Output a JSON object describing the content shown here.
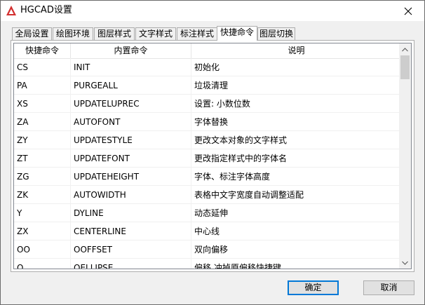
{
  "window": {
    "title": "HGCAD设置"
  },
  "tabs": [
    {
      "label": "全局设置"
    },
    {
      "label": "绘图环境"
    },
    {
      "label": "图层样式"
    },
    {
      "label": "文字样式"
    },
    {
      "label": "标注样式"
    },
    {
      "label": "快捷命令",
      "active": true
    },
    {
      "label": "图层切换"
    }
  ],
  "table": {
    "headers": [
      "快捷命令",
      "内置命令",
      "说明"
    ],
    "rows": [
      [
        "CS",
        "INIT",
        "初始化"
      ],
      [
        "PA",
        "PURGEALL",
        "垃圾清理"
      ],
      [
        "XS",
        "UPDATELUPREC",
        "设置: 小数位数"
      ],
      [
        "ZA",
        "AUTOFONT",
        "字体替换"
      ],
      [
        "ZY",
        "UPDATESTYLE",
        "更改文本对象的文字样式"
      ],
      [
        "ZT",
        "UPDATEFONT",
        "更改指定样式中的字体名"
      ],
      [
        "ZG",
        "UPDATEHEIGHT",
        "字体、标注字体高度"
      ],
      [
        "ZK",
        "AUTOWIDTH",
        "表格中文字宽度自动调整适配"
      ],
      [
        "Y",
        "DYLINE",
        "动态延伸"
      ],
      [
        "ZX",
        "CENTERLINE",
        "中心线"
      ],
      [
        "OO",
        "OOFFSET",
        "双向偏移"
      ],
      [
        "O",
        "OELLIPSE",
        "偏移,冲掉原偏移快捷键"
      ]
    ]
  },
  "buttons": {
    "ok": "确定",
    "cancel": "取消"
  },
  "colors": {
    "accent": "#0078d7",
    "app_icon": "#d32f2f"
  }
}
